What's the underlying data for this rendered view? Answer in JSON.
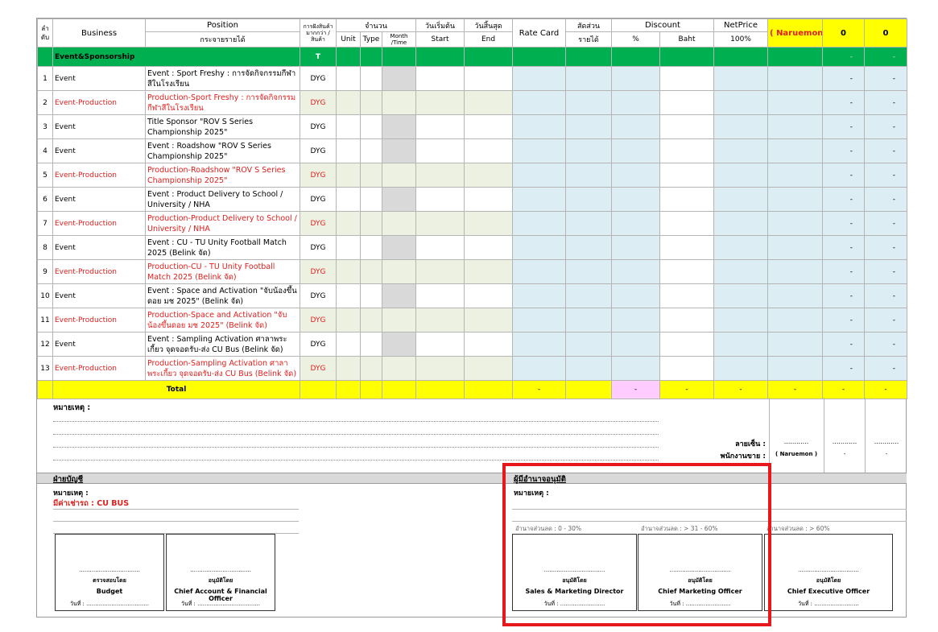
{
  "header": {
    "row_no_label": "ลำ\nดับ",
    "business": "Business",
    "position": "Position",
    "position_sub": "กระจายรายได้",
    "product_type": "การฝังสินค้า",
    "product_type_sub": "มากกว่า / สินค้า",
    "quantity": "จำนวน",
    "unit": "Unit",
    "type": "Type",
    "month": "Month",
    "month_time": "/Time",
    "start_th": "วันเริ่มต้น",
    "start": "Start",
    "end_th": "วันสิ้นสุด",
    "end": "End",
    "rate_card": "Rate Card",
    "share_th": "สัดส่วน",
    "share_sub": "รายได้",
    "discount": "Discount",
    "discount_pct": "%",
    "discount_baht": "Baht",
    "netprice": "NetPrice",
    "netprice_pct": "100%",
    "person": "( Naruemon )",
    "col_a": "0",
    "col_b": "0"
  },
  "section": {
    "label": "Event&Sponsorship",
    "code": "T",
    "dash_a": "-",
    "dash_b": "-"
  },
  "rows": [
    {
      "no": "1",
      "business": "Event",
      "position": "Event : Sport Freshy : การจัดกิจกรรมกีฬาสีในโรงเรียน",
      "code": "DYG",
      "dash_a": "-",
      "dash_b": "-"
    },
    {
      "no": "2",
      "business": "Event-Production",
      "position": "Production-Sport Freshy : การจัดกิจกรรมกีฬาสีในโรงเรียน",
      "code": "DYG",
      "dash_a": "-",
      "dash_b": "-"
    },
    {
      "no": "3",
      "business": "Event",
      "position": "Title Sponsor \"ROV S Series Championship 2025\"",
      "code": "DYG",
      "dash_a": "-",
      "dash_b": "-"
    },
    {
      "no": "4",
      "business": "Event",
      "position": "Event : Roadshow \"ROV S Series Championship 2025\"",
      "code": "DYG",
      "dash_a": "-",
      "dash_b": "-"
    },
    {
      "no": "5",
      "business": "Event-Production",
      "position": "Production-Roadshow \"ROV S Series Championship 2025\"",
      "code": "DYG",
      "dash_a": "-",
      "dash_b": "-"
    },
    {
      "no": "6",
      "business": "Event",
      "position": "Event : Product Delivery to School / University / NHA",
      "code": "DYG",
      "dash_a": "-",
      "dash_b": "-"
    },
    {
      "no": "7",
      "business": "Event-Production",
      "position": "Production-Product Delivery to School / University / NHA",
      "code": "DYG",
      "dash_a": "-",
      "dash_b": "-"
    },
    {
      "no": "8",
      "business": "Event",
      "position": "Event : CU - TU Unity Football Match 2025 (Belink จัด)",
      "code": "DYG",
      "dash_a": "-",
      "dash_b": "-"
    },
    {
      "no": "9",
      "business": "Event-Production",
      "position": "Production-CU - TU Unity Football Match 2025 (Belink จัด)",
      "code": "DYG",
      "dash_a": "-",
      "dash_b": "-"
    },
    {
      "no": "10",
      "business": "Event",
      "position": "Event : Space and Activation \"จับน้องขึ้นดอย มช 2025\" (Belink จัด)",
      "code": "DYG",
      "dash_a": "-",
      "dash_b": "-"
    },
    {
      "no": "11",
      "business": "Event-Production",
      "position": "Production-Space and Activation \"จับน้องขึ้นดอย มช 2025\" (Belink จัด)",
      "code": "DYG",
      "dash_a": "-",
      "dash_b": "-"
    },
    {
      "no": "12",
      "business": "Event",
      "position": "Event : Sampling Activation ศาลาพระเกี้ยว จุดจอดรับ-ส่ง CU Bus (Belink จัด)",
      "code": "DYG",
      "dash_a": "-",
      "dash_b": "-"
    },
    {
      "no": "13",
      "business": "Event-Production",
      "position": "Production-Sampling Activation ศาลาพระเกี้ยว จุดจอดรับ-ส่ง CU Bus (Belink จัด)",
      "code": "DYG",
      "dash_a": "-",
      "dash_b": "-"
    }
  ],
  "total": {
    "label": "Total",
    "rate_card": "-",
    "discount_pct": "-",
    "discount_baht": "-",
    "netprice": "-",
    "person": "-",
    "col_a": "-",
    "col_b": "-"
  },
  "notes": {
    "title": "หมายเหตุ :",
    "signature_label": "ลายเซ็น  :",
    "sales_label": "พนักงานขาย :",
    "sig_dots": "............",
    "person": "( Naruemon )",
    "dash_a": "-",
    "dash_b": "-"
  },
  "accounting": {
    "title": "ฝ่ายบัญชี",
    "note_label": "หมายเหตุ :",
    "note_text": "มีค่าเช่ารถ : CU BUS",
    "box1": {
      "dots": "..................................",
      "action": "ตรวจสอบโดย",
      "role": "Budget",
      "date": "วันที่ : ..................................."
    },
    "box2": {
      "dots": "..................................",
      "action": "อนุมัติโดย",
      "role": "Chief Account & Financial Officer",
      "date": "วันที่ : ..................................."
    }
  },
  "approval": {
    "title": "ผู้มีอำนาจอนุมัติ",
    "note_label": "หมายเหตุ :",
    "tier1": "อำนาจส่วนลด : 0 - 30%",
    "tier2": "อำนาจส่วนลด : > 31 - 60%",
    "tier3": "อำนาจส่วนลด : > 60%",
    "box1": {
      "dots": "..................................",
      "action": "อนุมัติโดย",
      "role": "Sales & Marketing Director",
      "date": "วันที่ : ........................."
    },
    "box2": {
      "dots": "..................................",
      "action": "อนุมัติโดย",
      "role": "Chief Marketing Officer",
      "date": "วันที่ : ........................."
    },
    "box3": {
      "dots": "..................................",
      "action": "อนุมัติโดย",
      "role": "Chief Executive Officer",
      "date": "วันที่ : ........................."
    }
  },
  "highlight_color": "#e8171b"
}
